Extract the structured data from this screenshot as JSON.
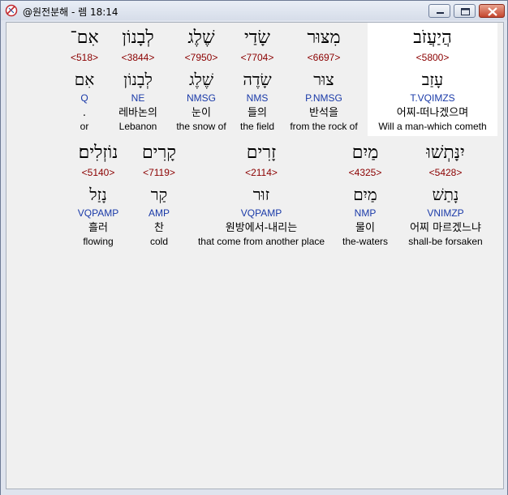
{
  "window": {
    "title": "@원전분해 - 렘 18:14",
    "buttons": {
      "minimize": "minimize-icon",
      "maximize": "maximize-icon",
      "close": "close-icon"
    }
  },
  "verse": {
    "rows": [
      {
        "words": [
          {
            "heb": "אִם־",
            "num": "<518>",
            "root": "אִם",
            "parse": "Q",
            "kor": ".",
            "eng": "or"
          },
          {
            "heb": "לְבָנוֹן",
            "num": "<3844>",
            "root": "לְבָנוֹן",
            "parse": "NE",
            "kor": "레바논의",
            "eng": "Lebanon"
          },
          {
            "heb": "שֶׁלֶג",
            "num": "<7950>",
            "root": "שֶׁלֶג",
            "parse": "NMSG",
            "kor": "눈이",
            "eng": "the snow of"
          },
          {
            "heb": "שָׂדַי",
            "num": "<7704>",
            "root": "שָׂדֶה",
            "parse": "NMS",
            "kor": "들의",
            "eng": "the field"
          },
          {
            "heb": "מִצּוּר",
            "num": "<6697>",
            "root": "צוּר",
            "parse": "P.NMSG",
            "kor": "반석을",
            "eng": "from the rock of"
          },
          {
            "heb": "הֲיַעֲזֹב",
            "num": "<5800>",
            "root": "עָזַב",
            "parse": "T.VQIMZS",
            "kor": "어찌-떠나겠으며",
            "eng": "Will a man-which cometh",
            "selected": true
          }
        ]
      },
      {
        "words": [
          {
            "heb": "נוֹזְלִים׃",
            "num": "<5140>",
            "root": "נָזַל",
            "parse": "VQPAMP",
            "kor": "흘러",
            "eng": "flowing"
          },
          {
            "heb": "קָרִים",
            "num": "<7119>",
            "root": "קַר",
            "parse": "AMP",
            "kor": "찬",
            "eng": "cold"
          },
          {
            "heb": "זָרִים",
            "num": "<2114>",
            "root": "זוּר",
            "parse": "VQPAMP",
            "kor": "원방에서-내리는",
            "eng": "that come from another place"
          },
          {
            "heb": "מַיִם",
            "num": "<4325>",
            "root": "מַיִם",
            "parse": "NMP",
            "kor": "물이",
            "eng": "the-waters"
          },
          {
            "heb": "יִנָּתְשׁוּ",
            "num": "<5428>",
            "root": "נָתַשׁ",
            "parse": "VNIMZP",
            "kor": "어찌 마르겠느냐",
            "eng": "shall-be forsaken"
          }
        ]
      }
    ]
  }
}
